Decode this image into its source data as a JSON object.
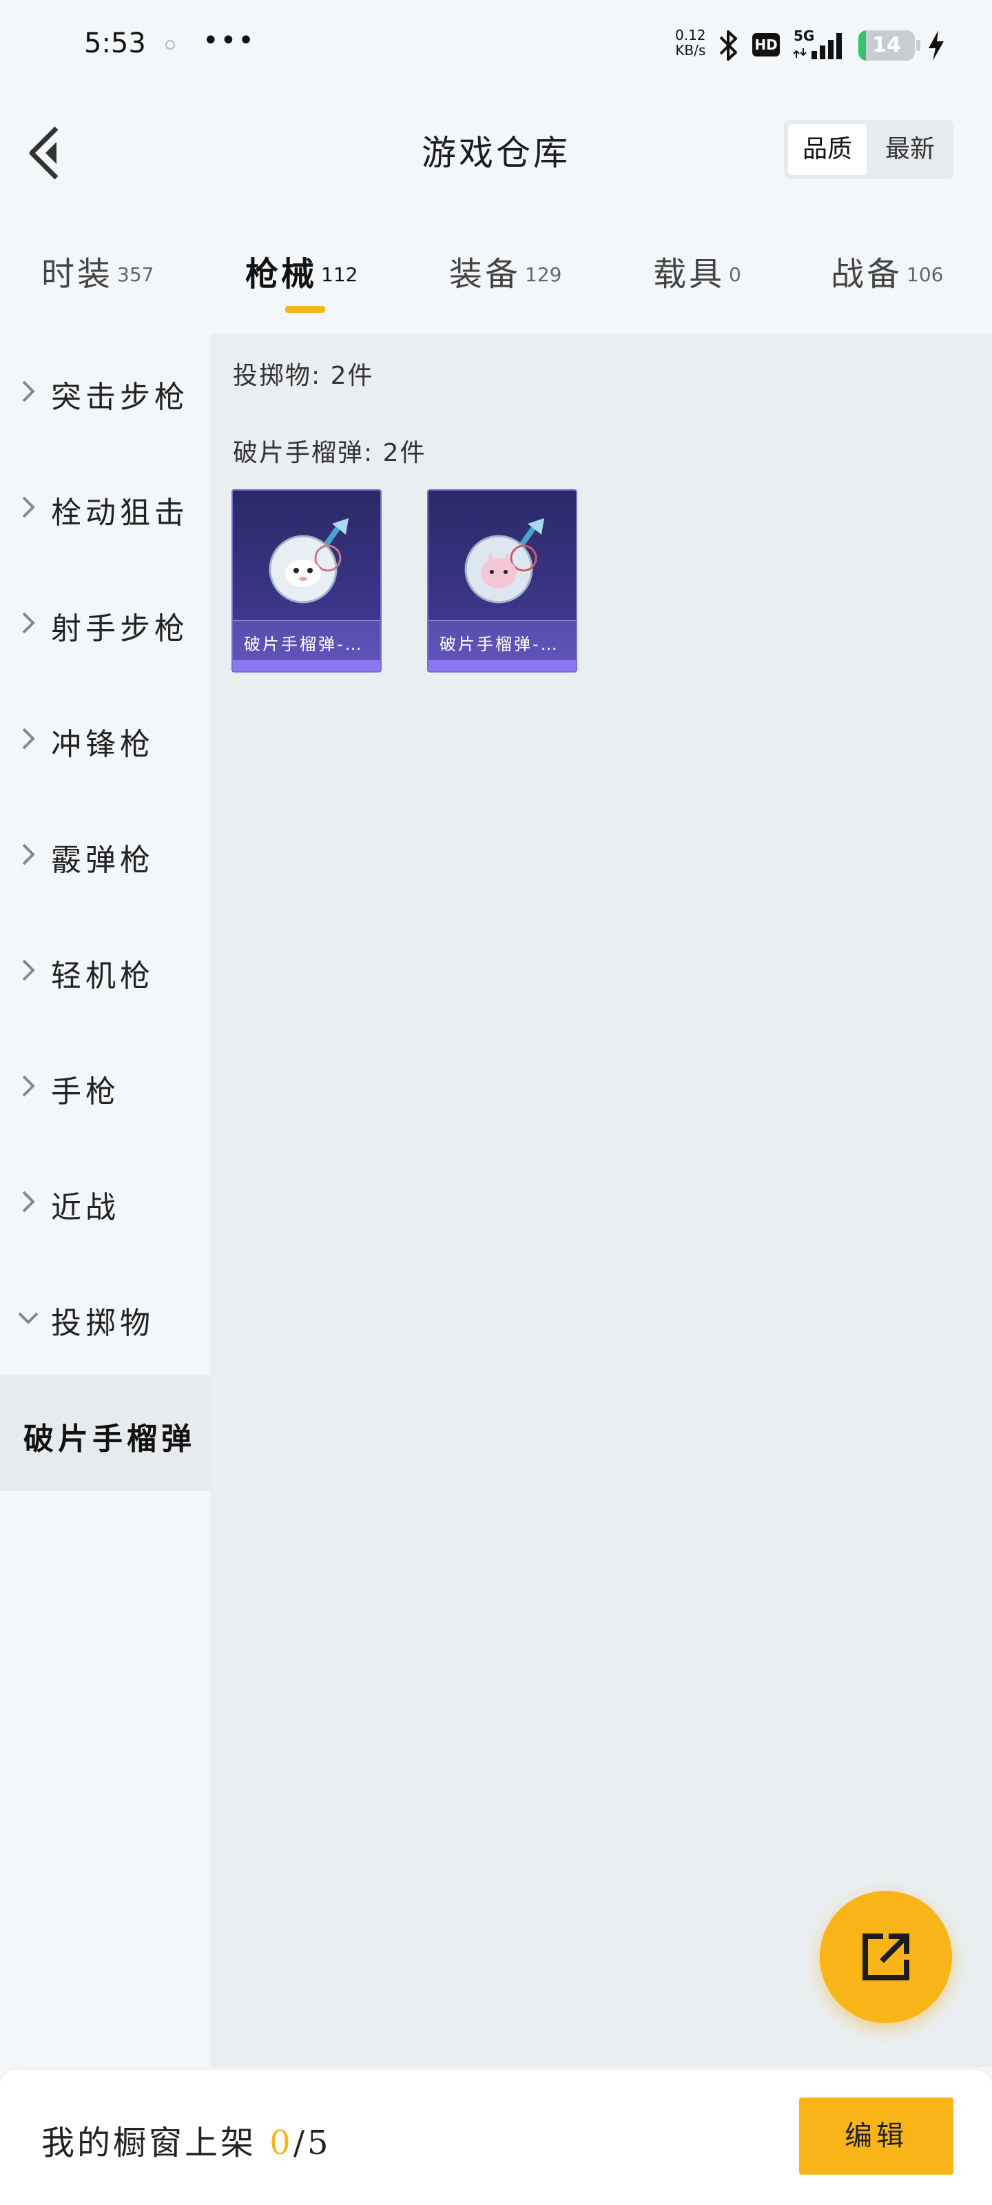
{
  "status_bar": {
    "time": "5:53",
    "more": "•••",
    "net_speed_value": "0.12",
    "net_speed_unit": "KB/s",
    "hd_badge": "HD",
    "network": "5G",
    "battery_level": "14",
    "battery_fraction": 0.14,
    "battery_color": "#35c26b",
    "icons": [
      "bluetooth-icon",
      "signal-icon",
      "battery-icon",
      "charging-icon"
    ]
  },
  "header": {
    "title": "游戏仓库",
    "sort_options": [
      {
        "label": "品质",
        "active": true
      },
      {
        "label": "最新",
        "active": false
      }
    ]
  },
  "tabs": [
    {
      "label": "时装",
      "count": "357",
      "active": false
    },
    {
      "label": "枪械",
      "count": "112",
      "active": true
    },
    {
      "label": "装备",
      "count": "129",
      "active": false
    },
    {
      "label": "载具",
      "count": "0",
      "active": false
    },
    {
      "label": "战备",
      "count": "106",
      "active": false
    }
  ],
  "sidebar": {
    "categories": [
      {
        "label": "突击步枪",
        "expanded": false
      },
      {
        "label": "栓动狙击",
        "expanded": false
      },
      {
        "label": "射手步枪",
        "expanded": false
      },
      {
        "label": "冲锋枪",
        "expanded": false
      },
      {
        "label": "霰弹枪",
        "expanded": false
      },
      {
        "label": "轻机枪",
        "expanded": false
      },
      {
        "label": "手枪",
        "expanded": false
      },
      {
        "label": "近战",
        "expanded": false
      },
      {
        "label": "投掷物",
        "expanded": true
      }
    ],
    "selected_sub": "破片手榴弹"
  },
  "content": {
    "group_title": "投掷物: 2件",
    "sub_title": "破片手榴弹: 2件",
    "items": [
      {
        "name": "破片手榴弹-…",
        "variant": "white-grenade"
      },
      {
        "name": "破片手榴弹-…",
        "variant": "pink-grenade"
      }
    ],
    "card_accent": "#8a78f0"
  },
  "fab": {
    "icon": "share-external-icon",
    "color": "#f9b417"
  },
  "bottom_bar": {
    "label_prefix": "我的橱窗上架 ",
    "listed": "0",
    "separator": "/",
    "limit": "5",
    "edit_label": "编辑"
  },
  "accent": "#f5b51e"
}
